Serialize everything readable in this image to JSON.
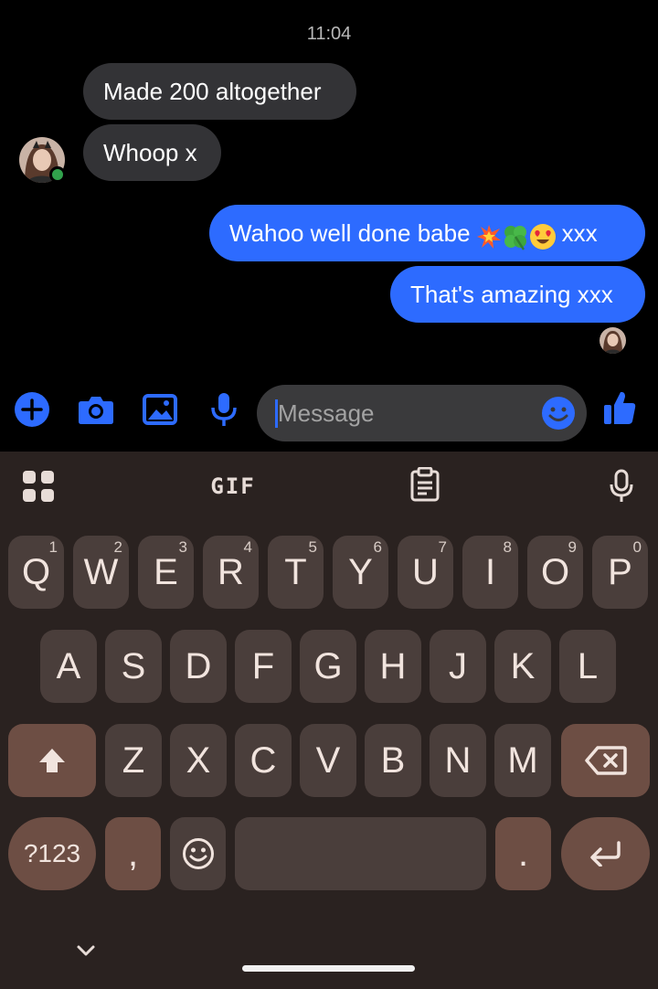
{
  "chat": {
    "timestamp": "11:04",
    "messages": [
      {
        "from": "contact",
        "text": "Made 200 altogether"
      },
      {
        "from": "contact",
        "text": "Whoop x"
      },
      {
        "from": "me",
        "text_before": "Wahoo well done babe",
        "emojis": [
          "collision",
          "four-leaf-clover",
          "heart-eyes"
        ],
        "text_after": "xxx"
      },
      {
        "from": "me",
        "text": "That's amazing xxx"
      }
    ],
    "contact_status": "online"
  },
  "composer": {
    "placeholder": "Message",
    "icons": [
      "plus-icon",
      "camera-icon",
      "image-icon",
      "mic-icon",
      "emoji-icon",
      "thumbs-up-icon"
    ],
    "accent_color": "#2d6bff"
  },
  "keyboard": {
    "toolbar": {
      "gif_label": "GIF",
      "icons": [
        "apps-grid-icon",
        "clipboard-icon",
        "mic-icon"
      ]
    },
    "row1": [
      {
        "label": "Q",
        "hint": "1"
      },
      {
        "label": "W",
        "hint": "2"
      },
      {
        "label": "E",
        "hint": "3"
      },
      {
        "label": "R",
        "hint": "4"
      },
      {
        "label": "T",
        "hint": "5"
      },
      {
        "label": "Y",
        "hint": "6"
      },
      {
        "label": "U",
        "hint": "7"
      },
      {
        "label": "I",
        "hint": "8"
      },
      {
        "label": "O",
        "hint": "9"
      },
      {
        "label": "P",
        "hint": "0"
      }
    ],
    "row2": [
      "A",
      "S",
      "D",
      "F",
      "G",
      "H",
      "J",
      "K",
      "L"
    ],
    "row3": [
      "Z",
      "X",
      "C",
      "V",
      "B",
      "N",
      "M"
    ],
    "row4": {
      "symbols_label": "?123",
      "comma": ",",
      "period": "."
    },
    "colors": {
      "background": "#2a2220",
      "key": "#4a3e3b",
      "function_key": "#6d4e44"
    }
  }
}
